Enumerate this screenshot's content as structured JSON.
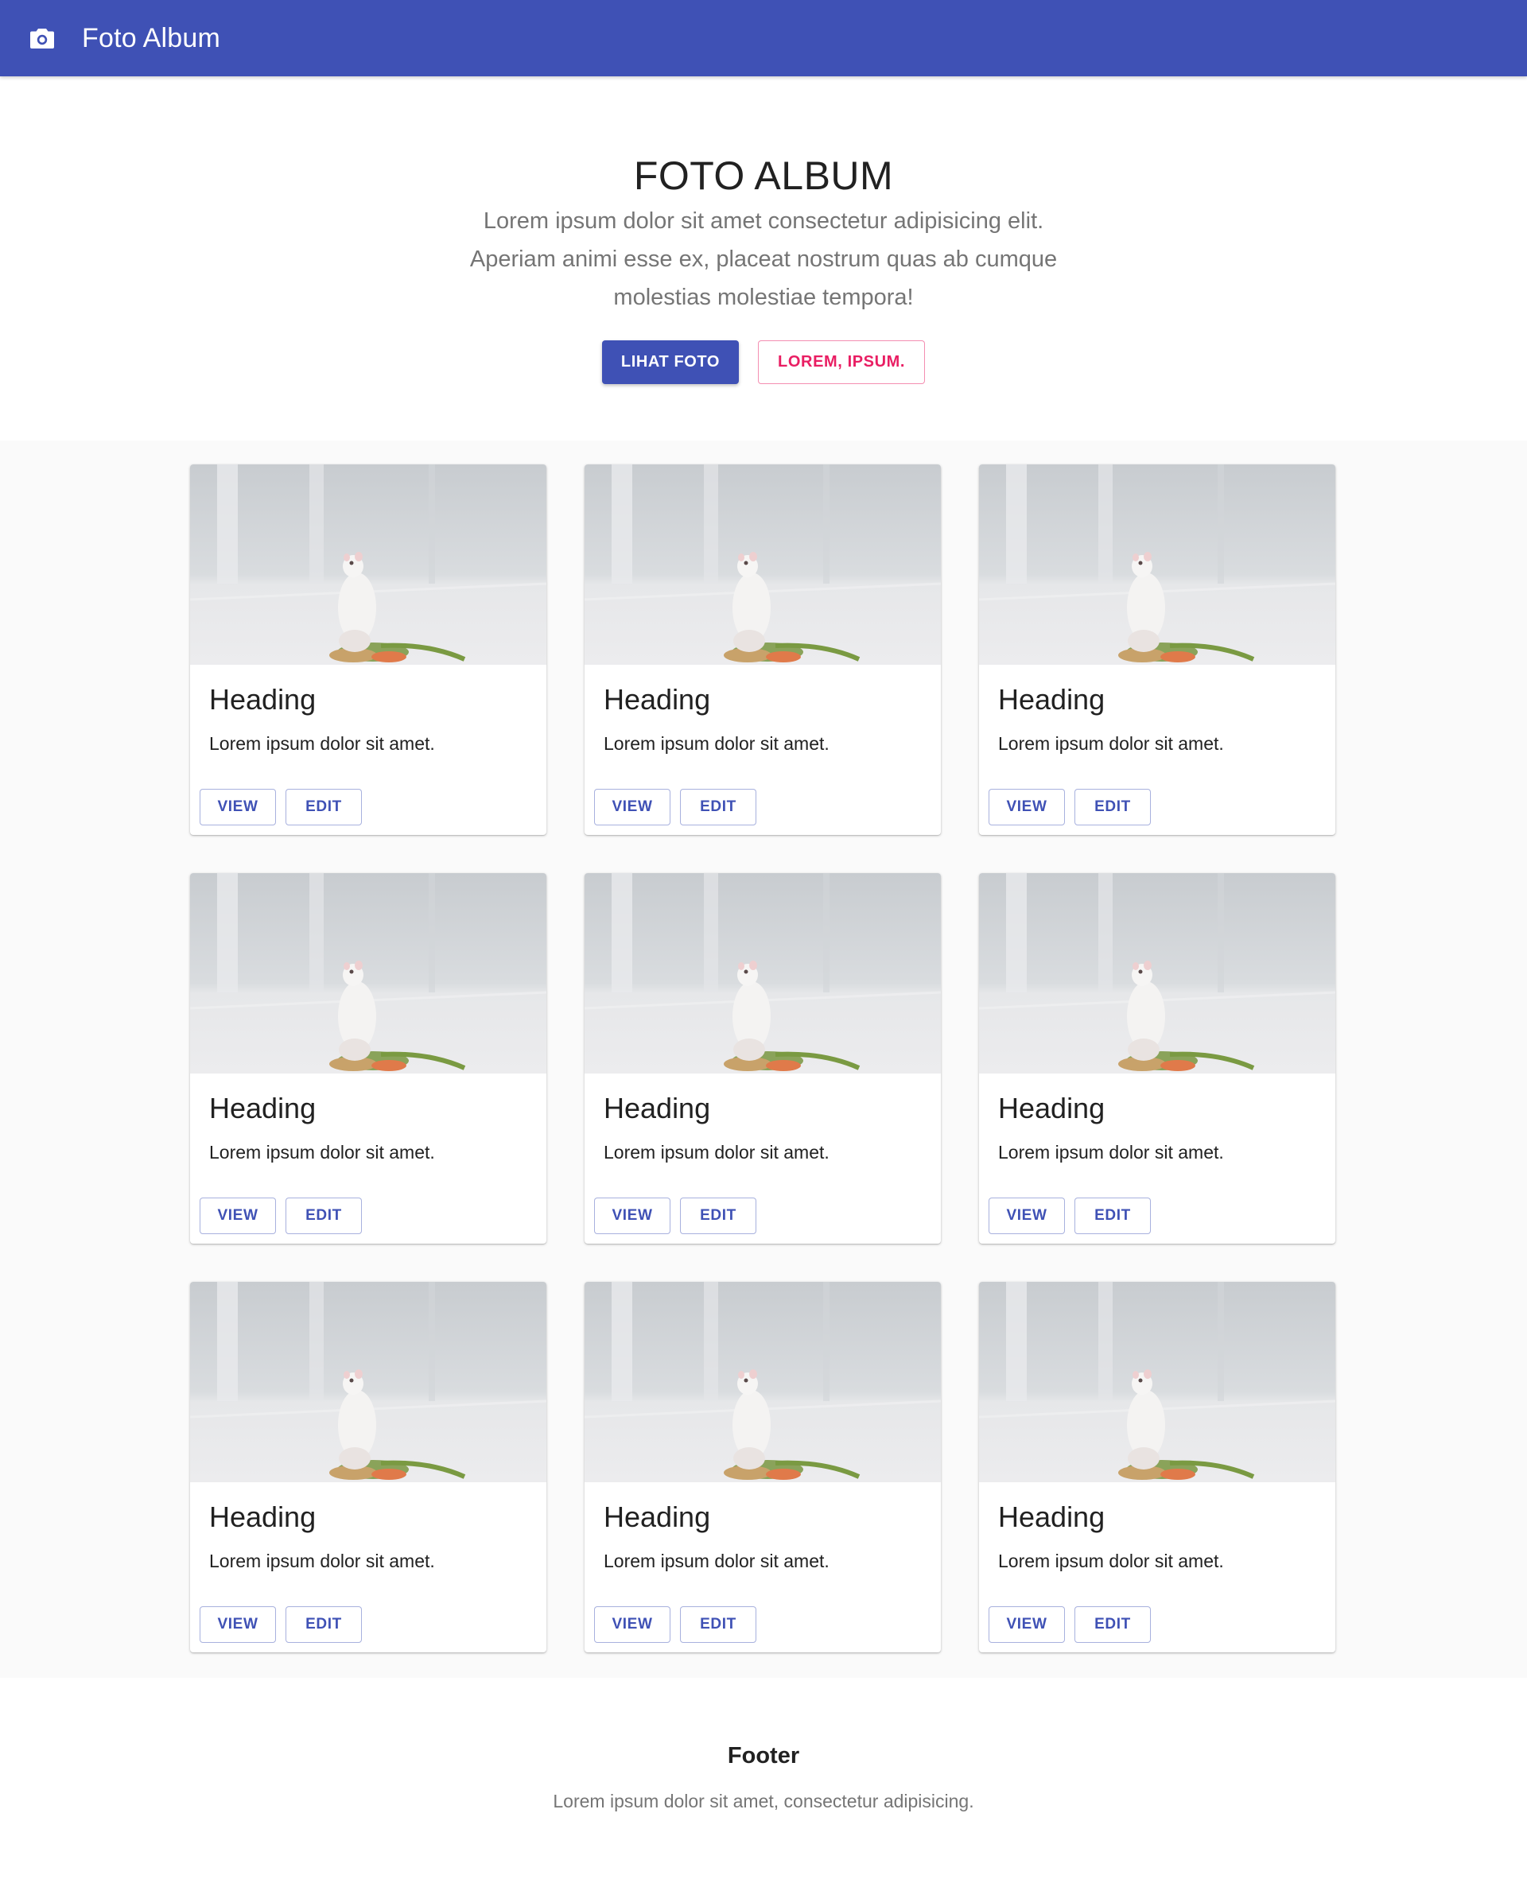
{
  "appbar": {
    "icon": "camera-icon",
    "title": "Foto Album",
    "color": "#3f51b5"
  },
  "hero": {
    "title": "FOTO ALBUM",
    "description": "Lorem ipsum dolor sit amet consectetur adipisicing elit. Aperiam animi esse ex, placeat nostrum quas ab cumque molestias molestiae tempora!",
    "primary_button": "LIHAT FOTO",
    "secondary_button": "LOREM, IPSUM.",
    "secondary_color": "#e91e63"
  },
  "cards": [
    {
      "heading": "Heading",
      "text": "Lorem ipsum dolor sit amet.",
      "view_label": "VIEW",
      "edit_label": "EDIT"
    },
    {
      "heading": "Heading",
      "text": "Lorem ipsum dolor sit amet.",
      "view_label": "VIEW",
      "edit_label": "EDIT"
    },
    {
      "heading": "Heading",
      "text": "Lorem ipsum dolor sit amet.",
      "view_label": "VIEW",
      "edit_label": "EDIT"
    },
    {
      "heading": "Heading",
      "text": "Lorem ipsum dolor sit amet.",
      "view_label": "VIEW",
      "edit_label": "EDIT"
    },
    {
      "heading": "Heading",
      "text": "Lorem ipsum dolor sit amet.",
      "view_label": "VIEW",
      "edit_label": "EDIT"
    },
    {
      "heading": "Heading",
      "text": "Lorem ipsum dolor sit amet.",
      "view_label": "VIEW",
      "edit_label": "EDIT"
    },
    {
      "heading": "Heading",
      "text": "Lorem ipsum dolor sit amet.",
      "view_label": "VIEW",
      "edit_label": "EDIT"
    },
    {
      "heading": "Heading",
      "text": "Lorem ipsum dolor sit amet.",
      "view_label": "VIEW",
      "edit_label": "EDIT"
    },
    {
      "heading": "Heading",
      "text": "Lorem ipsum dolor sit amet.",
      "view_label": "VIEW",
      "edit_label": "EDIT"
    }
  ],
  "footer": {
    "title": "Footer",
    "text": "Lorem ipsum dolor sit amet, consectetur adipisicing."
  }
}
